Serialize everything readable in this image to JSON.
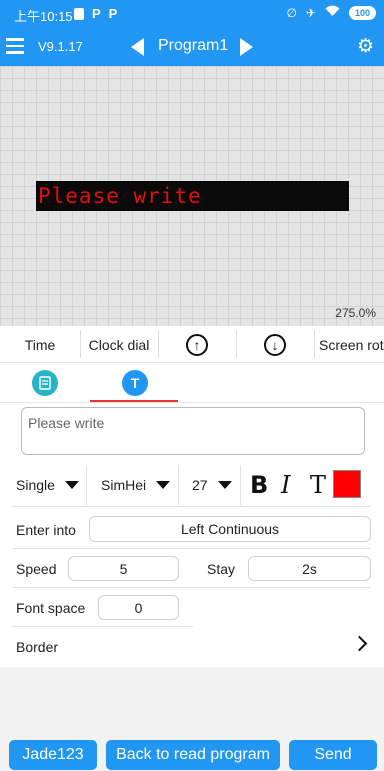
{
  "status_bar": {
    "time": "上午10:15",
    "p1": "P",
    "p2": "P",
    "battery": "100"
  },
  "app_bar": {
    "version": "V9.1.17",
    "program_title": "Program1"
  },
  "canvas": {
    "led_text": "Please write",
    "zoom": "275.0%"
  },
  "toolbar": {
    "time_label": "Time",
    "clock_dial_label": "Clock dial",
    "screen_rot_label": "Screen rot"
  },
  "text_input": {
    "placeholder": "Please write"
  },
  "font": {
    "line_mode": "Single",
    "font_name": "SimHei",
    "font_size": "27",
    "bold": "B",
    "italic": "I",
    "text_style": "T",
    "color": "#ff0000"
  },
  "settings": {
    "enter_into_label": "Enter into",
    "enter_into_value": "Left Continuous",
    "speed_label": "Speed",
    "speed_value": "5",
    "stay_label": "Stay",
    "stay_value": "2s",
    "font_space_label": "Font space",
    "font_space_value": "0",
    "border_label": "Border"
  },
  "bottom": {
    "user_button": "Jade123",
    "back_button": "Back to read program",
    "send_button": "Send"
  },
  "colors": {
    "primary": "#2196F3",
    "teal": "#26B5C6",
    "accent_red": "#e53935",
    "led_red": "#e01010"
  }
}
